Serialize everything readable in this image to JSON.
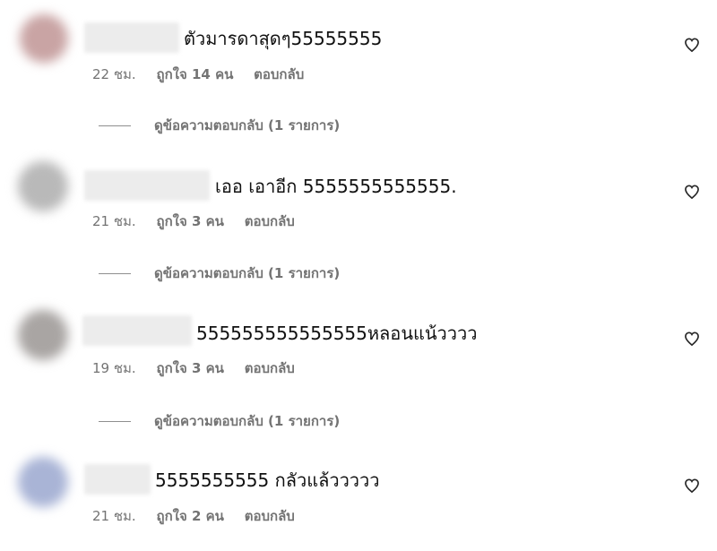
{
  "comments": [
    {
      "text": "ตัวมารดาสุดๆ55555555",
      "time": "22 ชม.",
      "likes": "ถูกใจ 14 คน",
      "reply": "ตอบกลับ",
      "view_replies": "ดูข้อความตอบกลับ (1 รายการ)",
      "avatar_color": "#c9a4a4",
      "icon": "heart-icon"
    },
    {
      "text": "เออ เอาอีก 5555555555555.",
      "time": "21 ชม.",
      "likes": "ถูกใจ 3 คน",
      "reply": "ตอบกลับ",
      "view_replies": "ดูข้อความตอบกลับ (1 รายการ)",
      "avatar_color": "#b9b9b9",
      "icon": "heart-icon"
    },
    {
      "text": "555555555555555หลอนแน้วววว",
      "time": "19 ชม.",
      "likes": "ถูกใจ 3 คน",
      "reply": "ตอบกลับ",
      "view_replies": "ดูข้อความตอบกลับ (1 รายการ)",
      "avatar_color": "#a9a5a3",
      "icon": "heart-icon"
    },
    {
      "text": "5555555555 กลัวแล้ววววว",
      "time": "21 ชม.",
      "likes": "ถูกใจ 2 คน",
      "reply": "ตอบกลับ",
      "avatar_color": "#a9b4d6",
      "icon": "heart-icon"
    }
  ]
}
